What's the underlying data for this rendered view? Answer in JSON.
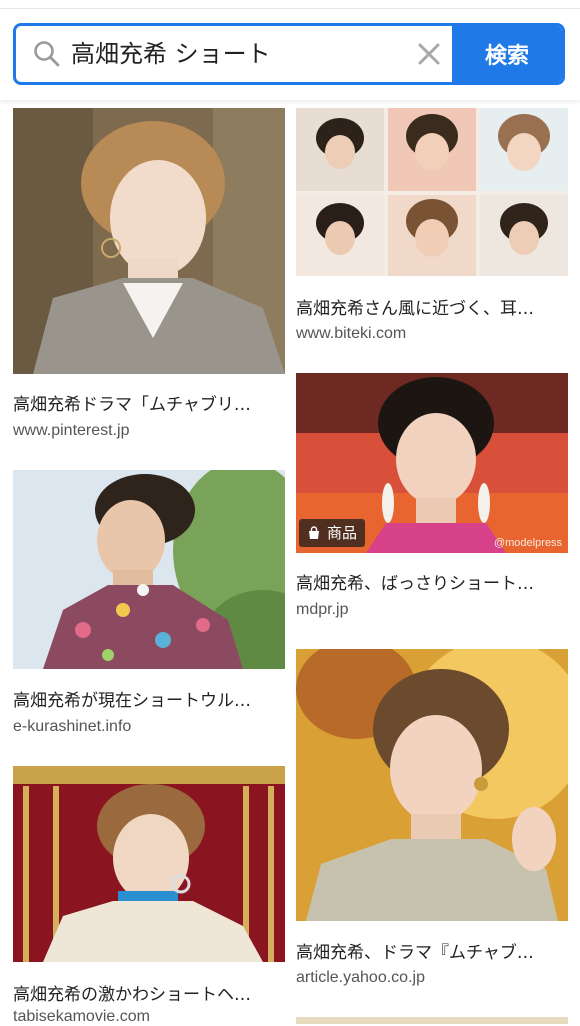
{
  "search": {
    "query": "高畑充希 ショート",
    "button_label": "検索"
  },
  "results": {
    "left": [
      {
        "title": "高畑充希ドラマ「ムチャブリ…",
        "source": "www.pinterest.jp"
      },
      {
        "title": "高畑充希が現在ショートウル…",
        "source": "e-kurashinet.info"
      },
      {
        "title": "高畑充希の激かわショートヘ…",
        "source": "tabisekamovie.com"
      }
    ],
    "right": [
      {
        "title": "高畑充希さん風に近づく、耳…",
        "source": "www.biteki.com"
      },
      {
        "title": "高畑充希、ばっさりショート…",
        "source": "mdpr.jp",
        "badge": "商品",
        "watermark": "@modelpress"
      },
      {
        "title": "高畑充希、ドラマ『ムチャブ…",
        "source": "article.yahoo.co.jp"
      }
    ]
  },
  "colors": {
    "accent": "#1f7ae8"
  }
}
